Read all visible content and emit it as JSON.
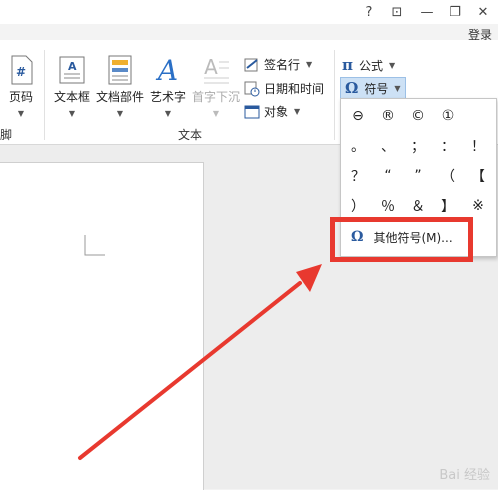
{
  "titlebar": {
    "help": "?",
    "ribbon_display": "⊡",
    "minimize": "—",
    "restore": "❐",
    "close": "✕",
    "login": "登录"
  },
  "ribbon": {
    "partial_left_label": "脚",
    "page_number_label": "页码",
    "textbox_label": "文本框",
    "docparts_label": "文档部件",
    "wordart_label": "艺术字",
    "dropcap_label": "首字下沉",
    "signature_label": "签名行",
    "datetime_label": "日期和时间",
    "object_label": "对象",
    "text_group_label": "文本",
    "equation_label": "公式",
    "symbol_label": "符号",
    "pi": "π",
    "omega": "Ω"
  },
  "symbols": [
    "⊖",
    "®",
    "©",
    "①",
    "",
    "。",
    "、",
    "；",
    "：",
    "！",
    "？",
    "“",
    "”",
    "（",
    "【",
    "）",
    "％",
    "＆",
    "】",
    "※"
  ],
  "dropdown": {
    "more_symbols": "其他符号(M)..."
  },
  "watermark": "Bai 经验",
  "colors": {
    "annotation_red": "#e8392f",
    "omega_blue": "#2a5a9e"
  }
}
